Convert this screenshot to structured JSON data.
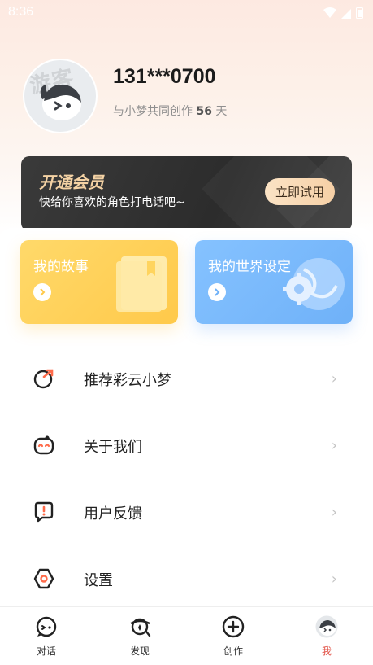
{
  "status_bar": {
    "time": "8:36"
  },
  "profile": {
    "avatar_watermark": "游客",
    "phone": "131***0700",
    "days_prefix": "与小梦共同创作",
    "days_count": "56",
    "days_suffix": "天"
  },
  "vip": {
    "title": "开通会员",
    "subtitle": "快给你喜欢的角色打电话吧~",
    "button_label": "立即试用"
  },
  "cards": [
    {
      "title": "我的故事",
      "icon": "book-icon",
      "color": "#ffd25a"
    },
    {
      "title": "我的世界设定",
      "icon": "globe-gear-icon",
      "color": "#7ab9fd"
    }
  ],
  "menu": [
    {
      "label": "推荐彩云小梦",
      "icon": "share-icon"
    },
    {
      "label": "关于我们",
      "icon": "robot-face-icon"
    },
    {
      "label": "用户反馈",
      "icon": "feedback-icon"
    },
    {
      "label": "设置",
      "icon": "settings-hex-icon"
    }
  ],
  "navbar": [
    {
      "label": "对话",
      "icon": "chat-icon"
    },
    {
      "label": "发现",
      "icon": "discover-icon"
    },
    {
      "label": "创作",
      "icon": "create-plus-icon"
    },
    {
      "label": "我",
      "icon": "profile-avatar-icon",
      "active": true
    }
  ],
  "colors": {
    "accent": "#e2554a",
    "vip_gold": "#f4d2a4"
  }
}
